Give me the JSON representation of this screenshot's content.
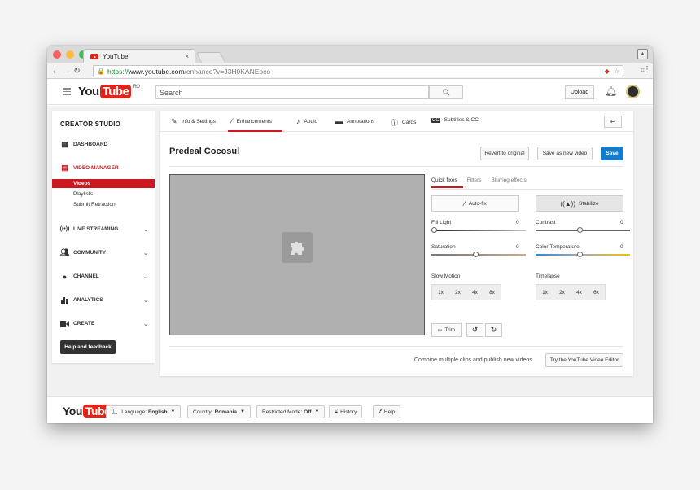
{
  "browser": {
    "tab_title": "YouTube",
    "tab_close": "×",
    "url_secure": "https://",
    "url_host": "www.youtube.com",
    "url_path": "/enhance?v=J3H0KANEpco"
  },
  "masthead": {
    "logo_you": "You",
    "logo_tube": "Tube",
    "logo_region": "RO",
    "search_placeholder": "Search",
    "upload_label": "Upload"
  },
  "sidebar": {
    "title": "CREATOR STUDIO",
    "dashboard": "DASHBOARD",
    "video_manager": "VIDEO MANAGER",
    "videos": "Videos",
    "playlists": "Playlists",
    "submit_retraction": "Submit Retraction",
    "live_streaming": "LIVE STREAMING",
    "community": "COMMUNITY",
    "channel": "CHANNEL",
    "analytics": "ANALYTICS",
    "create": "CREATE",
    "help": "Help and feedback"
  },
  "tabs": {
    "info": "Info & Settings",
    "enhancements": "Enhancements",
    "audio": "Audio",
    "annotations": "Annotations",
    "cards": "Cards",
    "subtitles": "Subtitles & CC"
  },
  "video": {
    "title": "Predeal Cocosul",
    "revert": "Revert to original",
    "save_new": "Save as new video",
    "save": "Save"
  },
  "enhance": {
    "tab_quick": "Quick fixes",
    "tab_filters": "Filters",
    "tab_blur": "Blurring effects",
    "autofix": "Auto-fix",
    "stabilize": "Stabilize",
    "fill_light": "Fill Light",
    "fill_light_val": "0",
    "contrast": "Contrast",
    "contrast_val": "0",
    "saturation": "Saturation",
    "saturation_val": "0",
    "color_temp": "Color Temperature",
    "color_temp_val": "0",
    "slow_motion": "Slow Motion",
    "timelapse": "Timelapse",
    "slow_speeds": [
      "1x",
      "2x",
      "4x",
      "8x"
    ],
    "time_speeds": [
      "1x",
      "2x",
      "4x",
      "6x"
    ],
    "trim": "Trim"
  },
  "editor": {
    "combine_text": "Combine multiple clips and publish new videos.",
    "try_editor": "Try the YouTube Video Editor"
  },
  "footer": {
    "logo_you": "You",
    "logo_tube": "Tube",
    "language_label": "Language:",
    "language_value": "English",
    "country_label": "Country:",
    "country_value": "Romania",
    "restricted_label": "Restricted Mode:",
    "restricted_value": "Off",
    "history": "History",
    "help": "Help"
  },
  "colors": {
    "brand_red": "#cc181e",
    "save_blue": "#167ac6"
  }
}
